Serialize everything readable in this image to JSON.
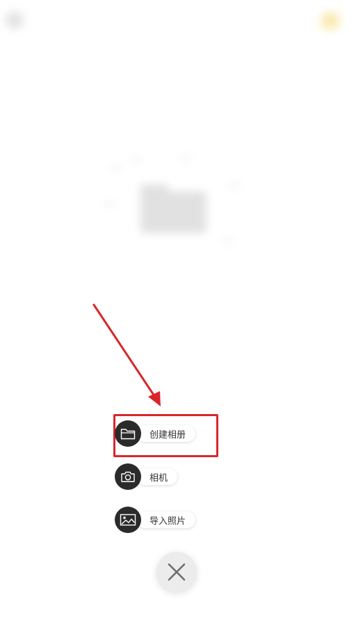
{
  "background": {
    "title": "",
    "empty_text": ""
  },
  "menu": {
    "items": [
      {
        "label": "创建相册",
        "icon": "folder-icon"
      },
      {
        "label": "相机",
        "icon": "camera-icon"
      },
      {
        "label": "导入照片",
        "icon": "image-icon"
      }
    ],
    "close_icon": "close-icon"
  },
  "colors": {
    "menu_circle": "#2b2b2b",
    "highlight": "#d9262a",
    "accent_yellow": "#f5dc7a"
  }
}
